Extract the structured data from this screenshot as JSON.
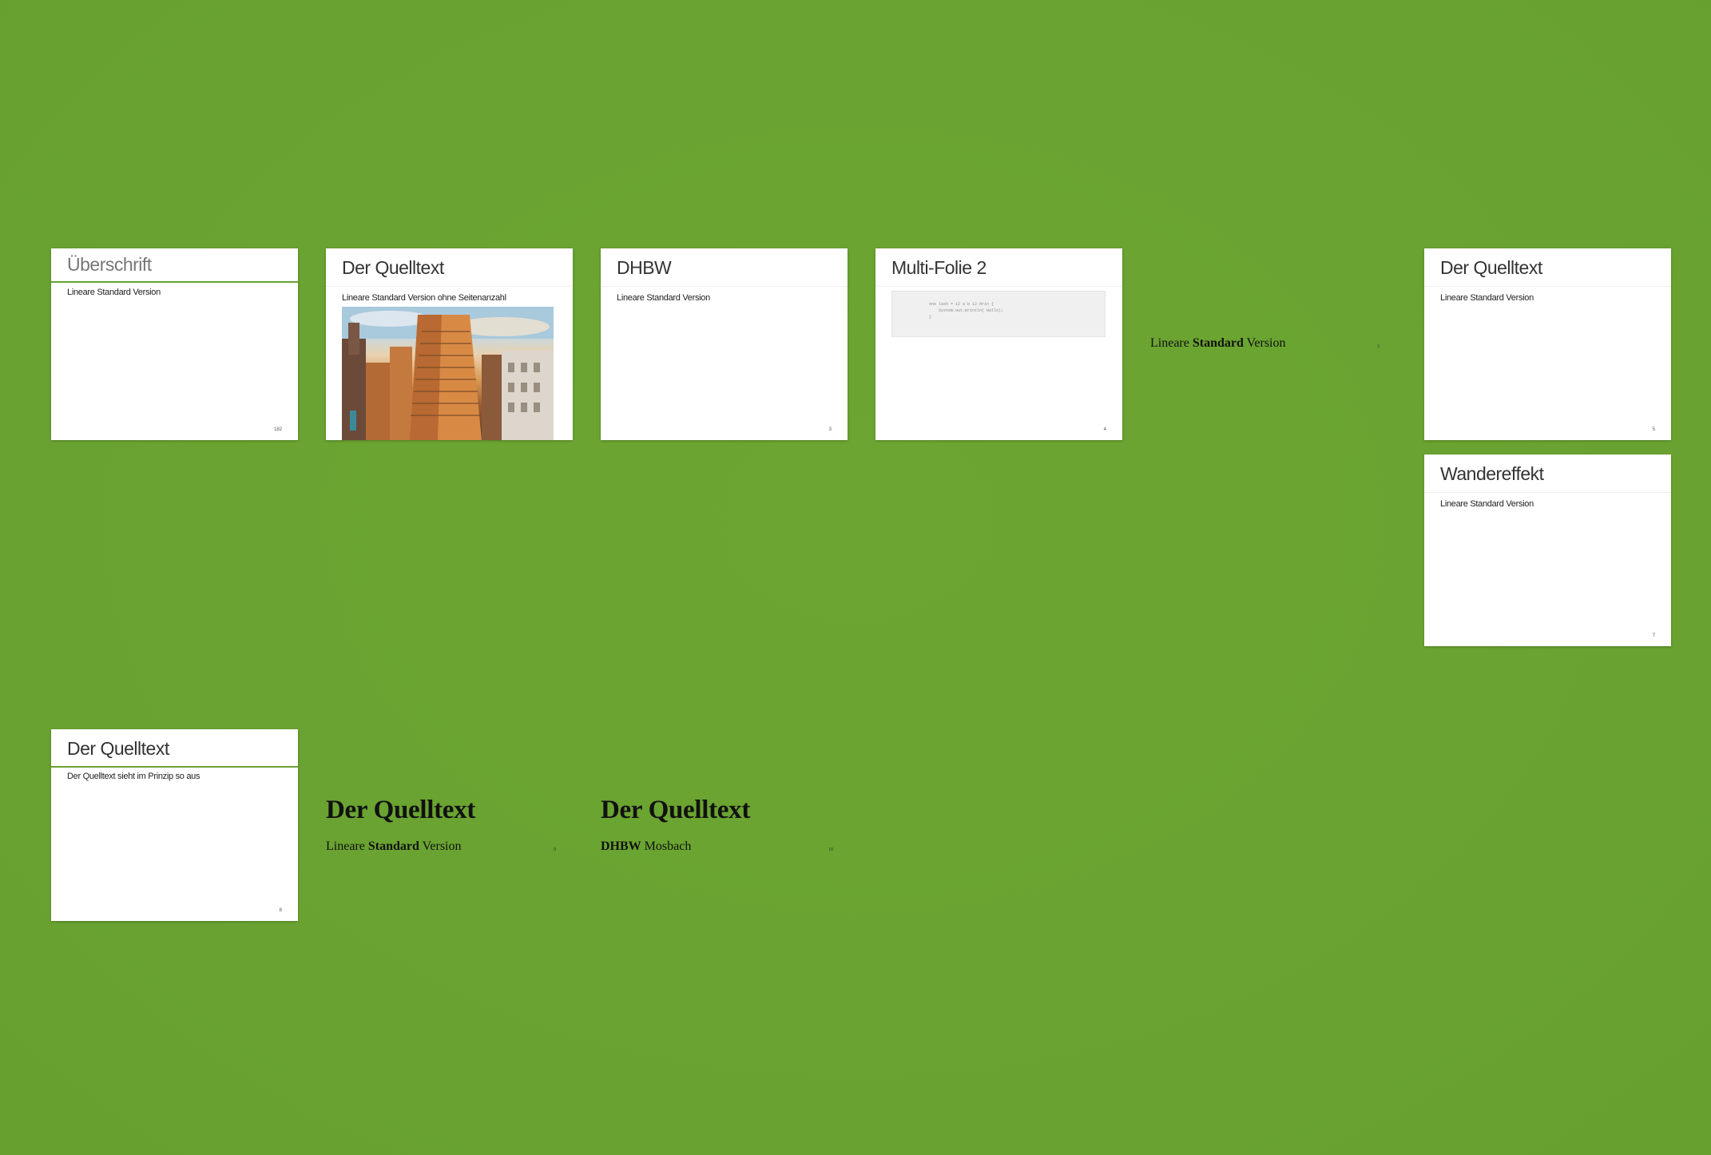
{
  "slides": [
    {
      "title": "Überschrift",
      "subtitle": "Lineare Standard Version",
      "page": "182"
    },
    {
      "title": "Der Quelltext",
      "subtitle": "Lineare Standard Version ohne Seitenanzahl"
    },
    {
      "title": "DHBW",
      "subtitle": "Lineare Standard Version",
      "page": "3"
    },
    {
      "title": "Multi-Folie 2",
      "code": "  one lash = i2 a b i2 drin {\n      System.out.println( Hallo);\n  }",
      "page": "4"
    },
    {
      "title": "Der Quelltext",
      "subtitle": "Lineare Standard Version",
      "page": "5"
    },
    {
      "title": "Wandereffekt",
      "subtitle": "Lineare Standard Version",
      "page": "7"
    },
    {
      "title": "Der Quelltext",
      "subtitle": "Der Quelltext sieht im Prinzip so aus",
      "page": "8"
    }
  ],
  "loose": [
    {
      "sub_a": "Lineare ",
      "sub_b": "Standard",
      "sub_c": " Version",
      "page": "3"
    },
    {
      "title": "Der Quelltext",
      "sub_a": "Lineare ",
      "sub_b": "Standard",
      "sub_c": " Version",
      "page": "9"
    },
    {
      "title": "Der Quelltext",
      "sub_b": "DHBW",
      "sub_c": " Mosbach",
      "page": "10"
    }
  ]
}
